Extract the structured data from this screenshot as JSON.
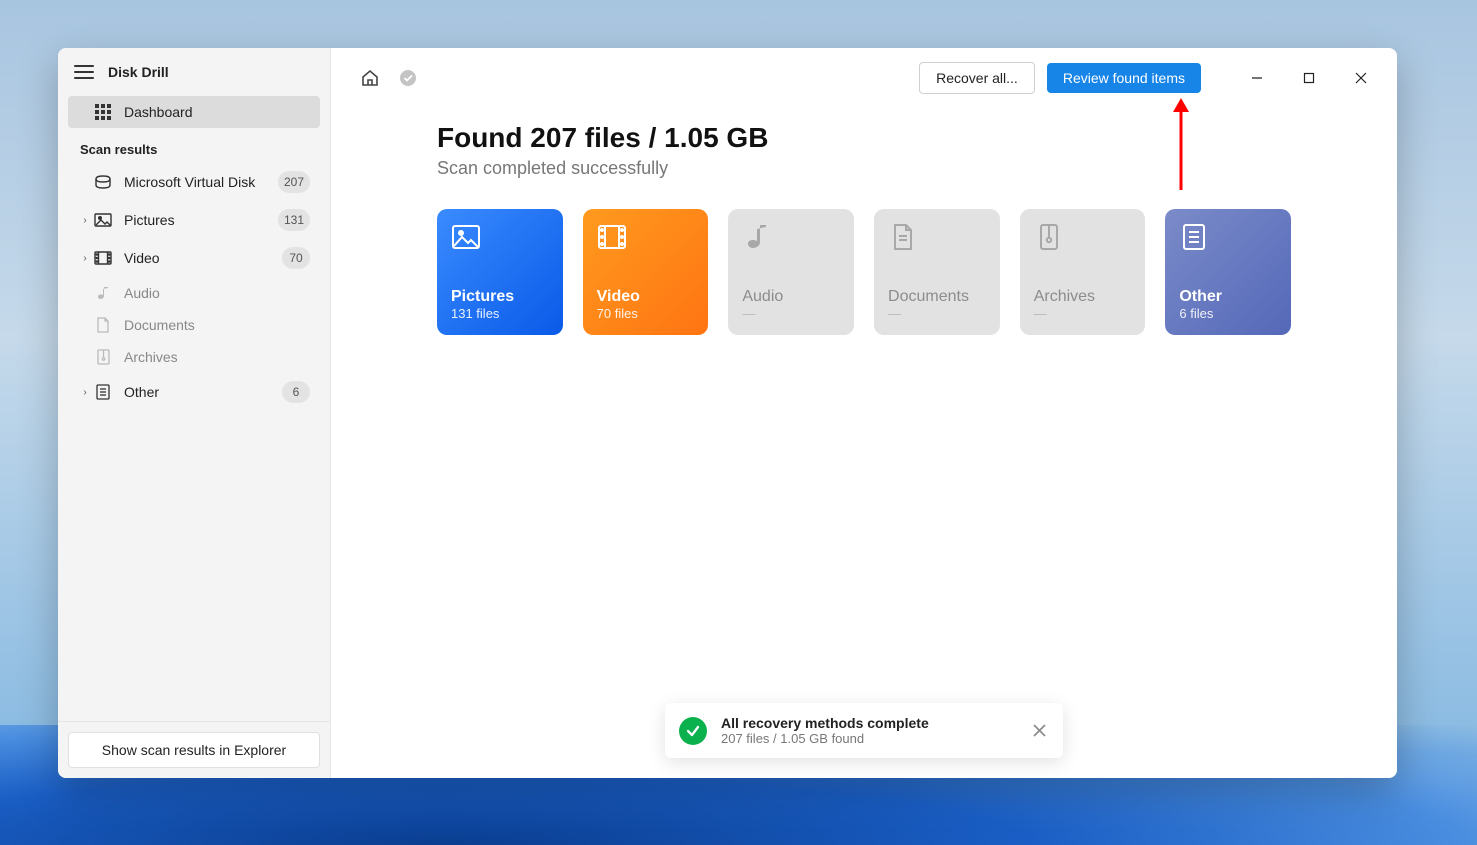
{
  "app": {
    "title": "Disk Drill"
  },
  "sidebar": {
    "dashboard": "Dashboard",
    "sectionTitle": "Scan results",
    "items": [
      {
        "label": "Microsoft Virtual Disk",
        "count": "207",
        "icon": "disk",
        "chev": ""
      },
      {
        "label": "Pictures",
        "count": "131",
        "icon": "picture",
        "chev": "›"
      },
      {
        "label": "Video",
        "count": "70",
        "icon": "video",
        "chev": "›"
      },
      {
        "label": "Audio",
        "count": "",
        "icon": "audio",
        "chev": ""
      },
      {
        "label": "Documents",
        "count": "",
        "icon": "document",
        "chev": ""
      },
      {
        "label": "Archives",
        "count": "",
        "icon": "archive",
        "chev": ""
      },
      {
        "label": "Other",
        "count": "6",
        "icon": "other",
        "chev": "›"
      }
    ],
    "footerButton": "Show scan results in Explorer"
  },
  "header": {
    "recoverAll": "Recover all...",
    "reviewFound": "Review found items"
  },
  "content": {
    "title": "Found 207 files / 1.05 GB",
    "subtitle": "Scan completed successfully",
    "tiles": [
      {
        "title": "Pictures",
        "sub": "131 files",
        "style": "blue"
      },
      {
        "title": "Video",
        "sub": "70 files",
        "style": "orange"
      },
      {
        "title": "Audio",
        "sub": "—",
        "style": "gray"
      },
      {
        "title": "Documents",
        "sub": "—",
        "style": "gray"
      },
      {
        "title": "Archives",
        "sub": "—",
        "style": "gray"
      },
      {
        "title": "Other",
        "sub": "6 files",
        "style": "purple"
      }
    ]
  },
  "toast": {
    "title": "All recovery methods complete",
    "sub": "207 files / 1.05 GB found"
  }
}
